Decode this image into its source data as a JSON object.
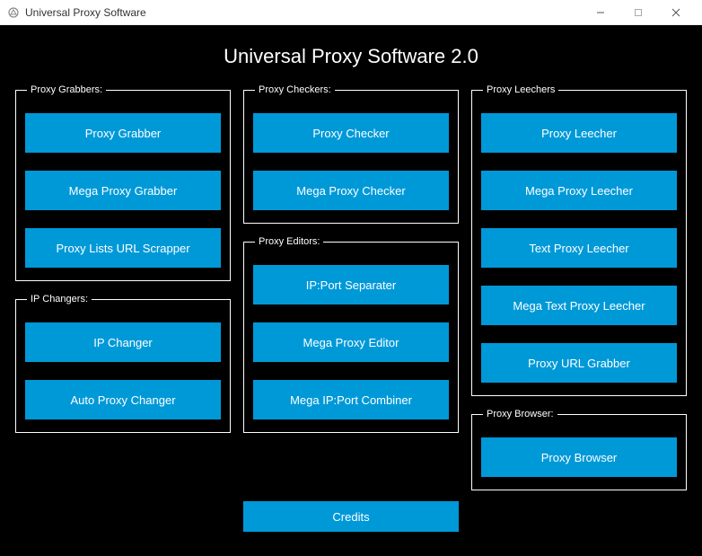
{
  "window": {
    "title": "Universal Proxy Software"
  },
  "app": {
    "heading": "Universal Proxy Software 2.0"
  },
  "groups": {
    "grabbers": {
      "legend": "Proxy Grabbers:",
      "buttons": [
        "Proxy Grabber",
        "Mega Proxy Grabber",
        "Proxy Lists URL Scrapper"
      ]
    },
    "changers": {
      "legend": "IP Changers:",
      "buttons": [
        "IP Changer",
        "Auto Proxy Changer"
      ]
    },
    "checkers": {
      "legend": "Proxy Checkers:",
      "buttons": [
        "Proxy Checker",
        "Mega Proxy Checker"
      ]
    },
    "editors": {
      "legend": "Proxy Editors:",
      "buttons": [
        "IP:Port Separater",
        "Mega Proxy Editor",
        "Mega IP:Port Combiner"
      ]
    },
    "leechers": {
      "legend": "Proxy Leechers",
      "buttons": [
        "Proxy Leecher",
        "Mega Proxy Leecher",
        "Text Proxy Leecher",
        "Mega Text Proxy Leecher",
        "Proxy URL Grabber"
      ]
    },
    "browser": {
      "legend": "Proxy Browser:",
      "buttons": [
        "Proxy Browser"
      ]
    }
  },
  "credits": {
    "label": "Credits"
  },
  "colors": {
    "accent": "#0099d8",
    "bg": "#000000"
  }
}
